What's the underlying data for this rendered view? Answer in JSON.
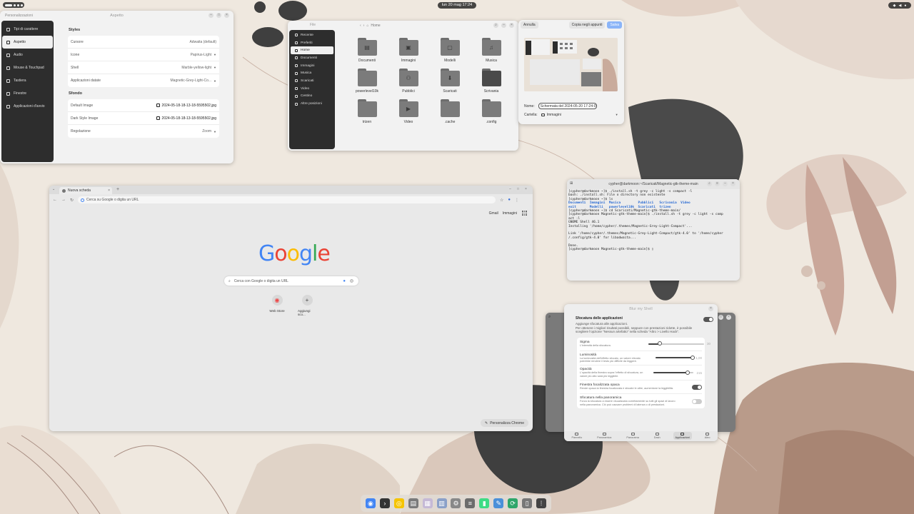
{
  "topbar": {
    "clock": "lun 20 mag 17:24"
  },
  "settings": {
    "title": "Aspetto",
    "sidebar_header": "Personalizzazioni",
    "sidebar": [
      {
        "label": "Tipi di carattere",
        "active": false
      },
      {
        "label": "Aspetto",
        "active": true
      },
      {
        "label": "Audio",
        "active": false
      },
      {
        "label": "Mouse & Touchpad",
        "active": false
      },
      {
        "label": "Tastiera",
        "active": false
      },
      {
        "label": "Finestre",
        "active": false
      },
      {
        "label": "Applicazioni d'avvio",
        "active": false
      }
    ],
    "styles_title": "Styles",
    "styles": [
      {
        "label": "Cursore",
        "value": "Adwaita (default)"
      },
      {
        "label": "Icone",
        "value": "Papirus-Light"
      },
      {
        "label": "Shell",
        "value": "Marble-yellow-light"
      },
      {
        "label": "Applicazioni datate",
        "value": "Magnetic-Grey-Light-Co..."
      }
    ],
    "bg_title": "Sfondo",
    "bg": [
      {
        "label": "Default Image",
        "value": "2024-05-18-18-13-18-5595502.jpg"
      },
      {
        "label": "Dark Style Image",
        "value": "2024-05-18-18-13-18-5595502.jpg"
      },
      {
        "label": "Regolazione",
        "value": "Zoom"
      }
    ]
  },
  "files": {
    "title": "File",
    "path": "Home",
    "sidebar": [
      {
        "label": "Recente",
        "active": false
      },
      {
        "label": "Preferiti",
        "active": false
      },
      {
        "label": "Home",
        "active": true
      },
      {
        "label": "Documenti",
        "active": false
      },
      {
        "label": "Immagini",
        "active": false
      },
      {
        "label": "Musica",
        "active": false
      },
      {
        "label": "Scaricati",
        "active": false
      },
      {
        "label": "Video",
        "active": false
      },
      {
        "label": "Cestino",
        "active": false
      },
      {
        "label": "Altre posizioni",
        "active": false
      }
    ],
    "folders": [
      {
        "name": "Documenti",
        "icon": "document-icon"
      },
      {
        "name": "Immagini",
        "icon": "image-icon"
      },
      {
        "name": "Modelli",
        "icon": "template-icon"
      },
      {
        "name": "Musica",
        "icon": "music-icon"
      },
      {
        "name": "powerlevel10k",
        "icon": ""
      },
      {
        "name": "Pubblici",
        "icon": "share-icon"
      },
      {
        "name": "Scaricati",
        "icon": "download-icon"
      },
      {
        "name": "Scrivania",
        "icon": "desktop-icon"
      },
      {
        "name": "trizen",
        "icon": ""
      },
      {
        "name": "Video",
        "icon": "video-icon"
      },
      {
        "name": ".cache",
        "icon": ""
      },
      {
        "name": ".config",
        "icon": ""
      }
    ]
  },
  "save_dialog": {
    "cancel": "Annulla",
    "copy": "Copia negli appunti",
    "save": "Salva",
    "name_label": "Nome:",
    "name_value": "Schermata del 2024-05-20 17-24-07.png",
    "folder_label": "Cartella:",
    "folder_value": "Immagini"
  },
  "chrome": {
    "tab_title": "Nuova scheda",
    "omnibox_placeholder": "Cerca su Google o digita un URL",
    "links": [
      "Gmail",
      "Immagini"
    ],
    "logo": "Google",
    "search_placeholder": "Cerca con Google o digita un URL",
    "shortcuts": [
      {
        "label": "Web Store"
      },
      {
        "label": "Aggiungi sco..."
      }
    ],
    "customize": "Personalizza Chrome"
  },
  "terminal": {
    "title": "cypher@darkmoon:~/Scaricati/Magnetic-gtk-theme-main",
    "lines": [
      "[cypher@darkmoon ~]$ ./install.sh -t grey -c light -s compact -l",
      "bash: ./install.sh: File o directory non esistente",
      "[cypher@darkmoon ~]$ ls"
    ],
    "ls_row1": "Documenti  Immagini  Musica         Pubblici   Scrivania  Video",
    "ls_row2": "exit       Modelli   powerlevel10k  Scaricati  trizen",
    "lines2": [
      "[cypher@darkmoon ~]$ cd Scaricati/Magnetic-gtk-theme-main/",
      "[cypher@darkmoon Magnetic-gtk-theme-main]$ ./install.sh -t grey -c light -s comp",
      "act -l",
      "GNOME Shell 46.1",
      "Installing '/home/cypher/.themes/Magnetic-Grey-Light-Compact'...",
      "",
      "Link '/home/cypher/.themes/Magnetic-Grey-Light-Compact/gtk-4.0' to '/home/cypher",
      "/.config/gtk-4.0' for libadwaita...",
      "",
      "Done.",
      "[cypher@darkmoon Magnetic-gtk-theme-main]$ ▯"
    ]
  },
  "blur": {
    "title": "Blur my Shell",
    "section_title": "Sfocatura delle applicazioni",
    "section_desc": "Aggiunge sfocatura alle applicazioni.\nPer ottenere i migliori risultati possibili, seppure con prestazioni ridotte, è possibile scegliere l'opzione \"Nessun artefatto\" nella scheda \"Altro > Livello Hack\".",
    "sigma_label": "Sigma",
    "sigma_desc": "L'intensità della sfocatura.",
    "sigma_value": "30",
    "sigma_fraction": 0.2,
    "brightness_label": "Luminosità",
    "brightness_desc": "La luminosità dell'effetto sfocato, un valore elevato potrebbe rendere il testo più difficile da leggere.",
    "brightness_value": "1,00",
    "brightness_fraction": 1.0,
    "opacity_label": "Opacità",
    "opacity_desc": "L'opacità della finestra sopra l'effetto di sfocatura, un valore più alto sarà più leggibile.",
    "opacity_value": "215",
    "opacity_fraction": 0.84,
    "focused_label": "Finestra focalizzata opaca",
    "focused_desc": "Rende opaca la finestra focalizzata e sfocate le altre, aumentone la leggibilità.",
    "overview_label": "Sfocatura nella panoramica",
    "overview_desc": "Forza la sfocatura a essere visualizzata correttamente su tutti gli spazi di lavoro nella panoramica. Ciò può causare problemi di latenza o di prestazioni.",
    "tabs": [
      {
        "label": "Pannello",
        "active": false
      },
      {
        "label": "Panoramica",
        "active": false
      },
      {
        "label": "Panorama",
        "active": false
      },
      {
        "label": "Dash",
        "active": false
      },
      {
        "label": "Applicazioni",
        "active": true
      },
      {
        "label": "Altro",
        "active": false
      }
    ]
  },
  "dock": [
    {
      "name": "chrome",
      "color": "#4285f4"
    },
    {
      "name": "terminal",
      "color": "#333333"
    },
    {
      "name": "rhythmbox",
      "color": "#f5c400"
    },
    {
      "name": "files",
      "color": "#7a7a7a"
    },
    {
      "name": "boxes",
      "color": "#c5b9d6"
    },
    {
      "name": "apps",
      "color": "#8aa0c8"
    },
    {
      "name": "settings",
      "color": "#888888"
    },
    {
      "name": "editor",
      "color": "#6c6c6c"
    },
    {
      "name": "android",
      "color": "#3ddc84"
    },
    {
      "name": "marker",
      "color": "#4a90d9"
    },
    {
      "name": "update",
      "color": "#2ea66a"
    },
    {
      "name": "trash",
      "color": "#777777"
    },
    {
      "name": "app-grid",
      "color": "#444444"
    }
  ]
}
